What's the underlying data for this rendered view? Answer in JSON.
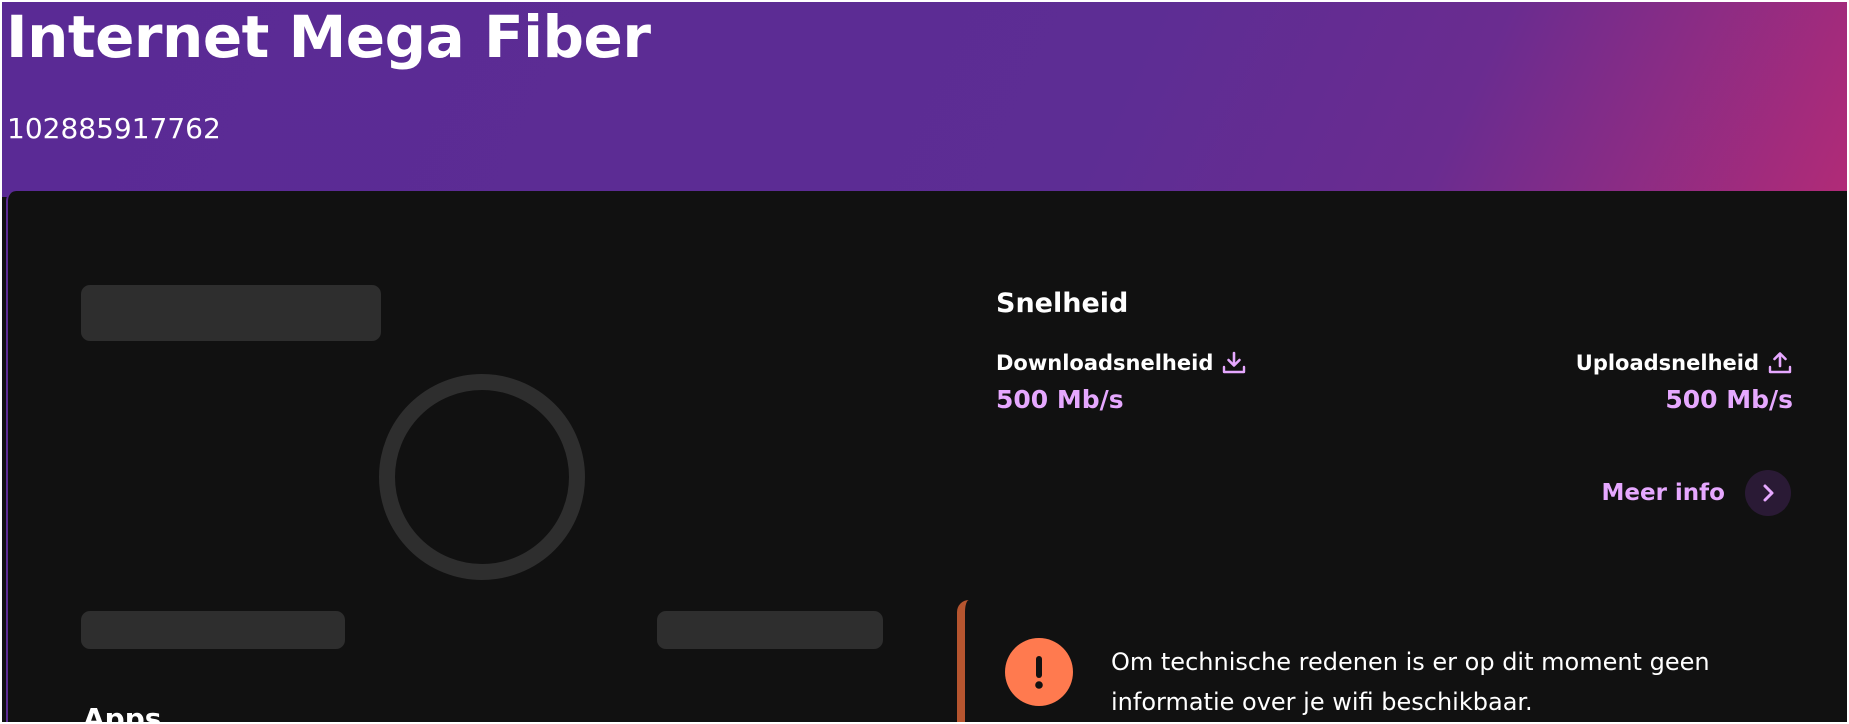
{
  "header": {
    "title": "Internet Mega Fiber",
    "account_number": "102885917762"
  },
  "speed": {
    "title": "Snelheid",
    "download": {
      "label": "Downloadsnelheid",
      "icon": "download-icon",
      "value": "500 Mb/s"
    },
    "upload": {
      "label": "Uploadsnelheid",
      "icon": "upload-icon",
      "value": "500 Mb/s"
    },
    "more_info": {
      "label": "Meer info",
      "icon": "chevron-right-icon"
    }
  },
  "notice": {
    "icon": "alert-icon",
    "text": "Om technische redenen is er op dit moment geen informatie over je wifi beschikbaar."
  },
  "apps": {
    "heading": "Apps"
  },
  "colors": {
    "header_gradient_start": "#5a2a95",
    "header_gradient_end": "#b12b77",
    "background": "#111111",
    "accent": "#e6a8ff",
    "skeleton": "#2e2e2e",
    "warning": "#ff7a4f",
    "warning_border": "#b6552f"
  }
}
